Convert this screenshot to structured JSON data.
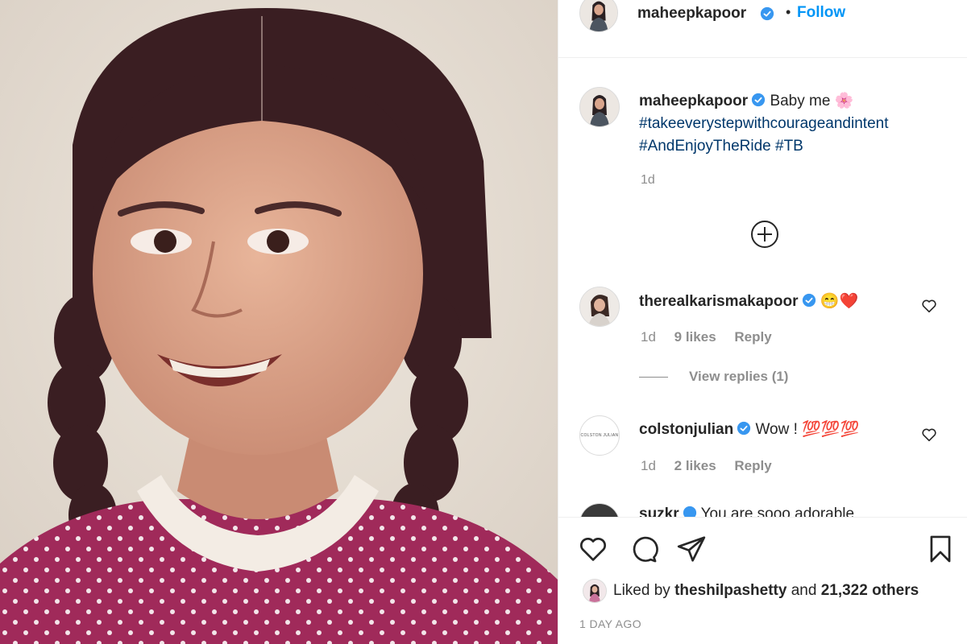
{
  "post": {
    "author": "maheepkapoor",
    "follow_label": "Follow",
    "header_separator": "•",
    "caption": {
      "username": "maheepkapoor",
      "text": "Baby me",
      "emoji": "🌸",
      "hashtags": [
        "#takeeverystepwithcourageandintent",
        "#AndEnjoyTheRide",
        "#TB"
      ],
      "time": "1d"
    }
  },
  "comments": [
    {
      "username": "therealkarismakapoor",
      "text": "😁❤️",
      "time": "1d",
      "likes": "9 likes",
      "reply_label": "Reply",
      "view_replies": "View replies (1)"
    },
    {
      "username": "colstonjulian",
      "text": "Wow ! 💯💯💯",
      "time": "1d",
      "likes": "2 likes",
      "reply_label": "Reply",
      "avatar_text": "COLSTON JULIAN"
    },
    {
      "username": "suzkr",
      "text": "You are sooo adorable"
    }
  ],
  "likes": {
    "prefix": "Liked by",
    "user": "theshilpashetty",
    "connector": "and",
    "others": "21,322 others"
  },
  "timestamp": "1 DAY AGO",
  "colors": {
    "link": "#0095f6",
    "hashtag": "#00376b",
    "muted": "#8e8e8e",
    "verified": "#3897f0"
  },
  "icons": {
    "like": "heart-outline-icon",
    "comment": "speech-bubble-icon",
    "share": "paper-plane-icon",
    "save": "bookmark-icon",
    "load_more": "plus-circle-icon",
    "verified": "verified-badge-icon"
  }
}
